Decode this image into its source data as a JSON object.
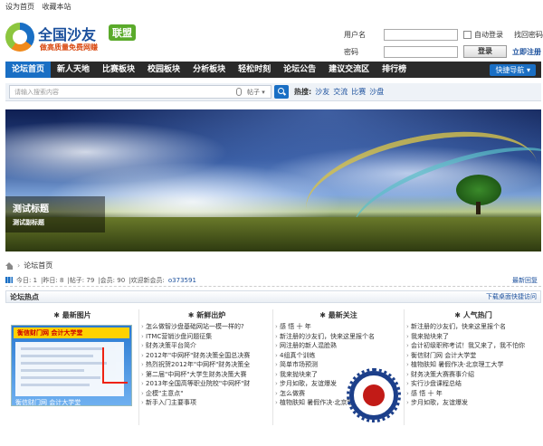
{
  "top_links": [
    "设为首页",
    "收藏本站"
  ],
  "logo": {
    "name": "全国沙友",
    "badge": "联盟",
    "slogan": "做高质量免费网赚"
  },
  "login": {
    "username_label": "用户名",
    "password_label": "密码",
    "auto_login_label": "自动登录",
    "forgot_label": "找回密码",
    "login_button": "登录",
    "register_label": "立即注册"
  },
  "nav": {
    "items": [
      "论坛首页",
      "新人天地",
      "比赛板块",
      "校园板块",
      "分析板块",
      "轻松时刻",
      "论坛公告",
      "建议交流区",
      "排行榜"
    ],
    "active_index": 0,
    "quick_label": "快捷导航 ▾"
  },
  "search": {
    "placeholder": "请输入搜索内容",
    "type_label": "帖子 ▾",
    "hot_label": "热搜:",
    "hot_words": [
      "沙友",
      "交流",
      "比赛",
      "沙盘"
    ]
  },
  "banner": {
    "title": "测试标题",
    "subtitle": "测试副标题"
  },
  "breadcrumb": {
    "arrow": "›",
    "current": "论坛首页"
  },
  "stats": {
    "today": "今日: 1",
    "yesterday": "昨日: 8",
    "posts": "帖子: 79",
    "members": "会员: 90",
    "welcome": "欢迎新会员:",
    "new_member": "o373591",
    "latest_reply": "最新回复"
  },
  "hot_section": {
    "title": "论坛热点",
    "download_link": "下载桌面快捷访问"
  },
  "columns": [
    {
      "title": "最新图片",
      "items": []
    },
    {
      "title": "新鲜出炉",
      "items": [
        "怎么做智沙盘基础网站一模一样的?",
        "ITMC营销沙盘问题征集",
        "财务决策平台简介",
        "2012年\"中网杯\"财务决策全国总决赛",
        "热烈祝贺2012年\"中网杯\"财务决策全",
        "第二届\"中网杯\"大学生财务决策大赛",
        "2013年全国高等职业院校\"中网杯\"财",
        "企模\"主意点\"",
        "新手入门主要事项"
      ]
    },
    {
      "title": "最新关注",
      "items": [
        "感 悟 十 年",
        "新注册的沙友们，快来这里报个名",
        "网注册的新人混脸熟",
        "4组真个训练",
        "简单市场预测",
        "我来抛块来了",
        "步月如歌，友谊爆发",
        "怎么做赛",
        "植物肤知 暑假作决·北京理工大学"
      ]
    },
    {
      "title": "人气热门",
      "items": [
        "新注册的沙友们，快来这里报个名",
        "我来抛块来了",
        "会计初级职称考试！我又来了，我不怕你",
        "衡信财门网 会计大学堂",
        "植物肤知 暑假作决·北京理工大学",
        "财务决策大赛赛事介绍",
        "实行沙盘课程总结",
        "感 悟 十 年",
        "步月如歌，友谊爆发"
      ]
    }
  ],
  "promo": {
    "header": "衡信财门网 会计大学堂",
    "caption": "衡信财门网 会计大学堂"
  },
  "colors": {
    "nav_bg": "#2a2a2a",
    "nav_active": "#1a6fc4",
    "link": "#1a4f9c",
    "logo_orange": "#d9480f",
    "badge_green": "#5aaa2a"
  }
}
